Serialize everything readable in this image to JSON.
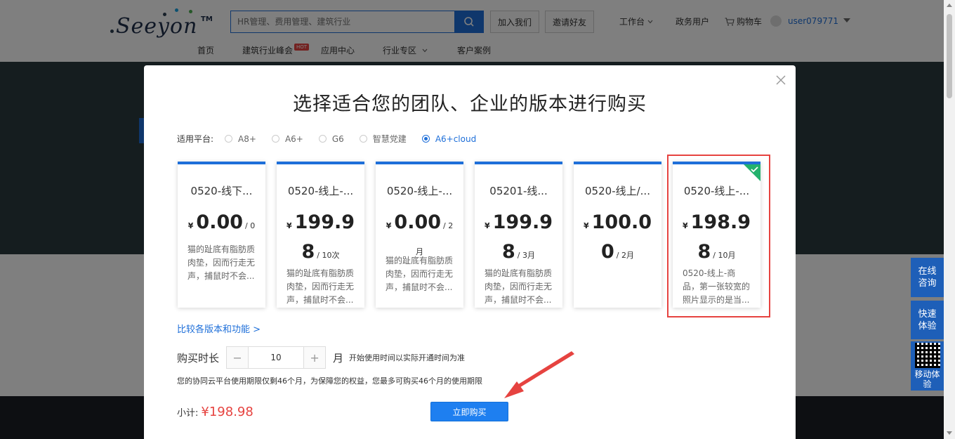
{
  "header": {
    "logo_text": "Seeyon",
    "logo_tm": "TM",
    "search_placeholder": "HR管理、费用管理、建筑行业",
    "join_label": "加入我们",
    "invite_label": "邀请好友",
    "workbench_label": "工作台",
    "gov_user_label": "政务用户",
    "cart_label": "购物车",
    "username": "user079771"
  },
  "nav": {
    "items": [
      "首页",
      "建筑行业峰会",
      "应用中心",
      "行业专区",
      "客户案例"
    ],
    "hot_badge": "HOT"
  },
  "side_float": {
    "consult": "在线\n咨询",
    "trial": "快速\n体验",
    "mobile": "移动体验"
  },
  "modal": {
    "title": "选择适合您的团队、企业的版本进行购买",
    "platform_label": "适用平台:",
    "platforms": [
      {
        "label": "A8+",
        "checked": false
      },
      {
        "label": "A6+",
        "checked": false
      },
      {
        "label": "G6",
        "checked": false
      },
      {
        "label": "智慧党建",
        "checked": false
      },
      {
        "label": "A6+cloud",
        "checked": true
      }
    ],
    "cards": [
      {
        "name": "0520-线下...",
        "yen": "¥",
        "amount": "0.00",
        "unit": "/ 0",
        "desc": "猫的趾底有脂肪质肉垫，因而行走无声，捕鼠时不会..."
      },
      {
        "name": "0520-线上-...",
        "yen": "¥",
        "amount": "199.98",
        "unit": "/ 10次",
        "desc": "猫的趾底有脂肪质肉垫，因而行走无声，捕鼠时不会..."
      },
      {
        "name": "0520-线上-...",
        "yen": "¥",
        "amount": "0.00",
        "unit": "/ 2月",
        "desc": "猫的趾底有脂肪质肉垫，因而行走无声，捕鼠时不会..."
      },
      {
        "name": "05201-线...",
        "yen": "¥",
        "amount": "199.98",
        "unit": "/ 3月",
        "desc": "猫的趾底有脂肪质肉垫，因而行走无声，捕鼠时不会..."
      },
      {
        "name": "0520-线上/...",
        "yen": "¥",
        "amount": "100.00",
        "unit": "/ 2月",
        "desc": ""
      },
      {
        "name": "0520-线上-...",
        "yen": "¥",
        "amount": "198.98",
        "unit": "/ 10月",
        "desc": "0520-线上-商品，第一张较宽的照片显示的是当..."
      }
    ],
    "selected_index": 5,
    "compare_link": "比较各版本和功能 >",
    "duration_label": "购买时长",
    "duration_value": "10",
    "stepper_minus": "−",
    "stepper_plus": "+",
    "month_label": "月",
    "duration_note": "开始使用时间以实际开通时间为准",
    "period_tip": "您的协同云平台使用期限仅剩46个月，为保障您的权益，您最多可购买46个月的使用期限",
    "subtotal_label": "小计:",
    "subtotal_value": "¥198.98",
    "buy_button": "立即购买"
  },
  "colors": {
    "accent": "#1e6fd9",
    "price_red": "#e64340",
    "check_green": "#23b26d"
  }
}
